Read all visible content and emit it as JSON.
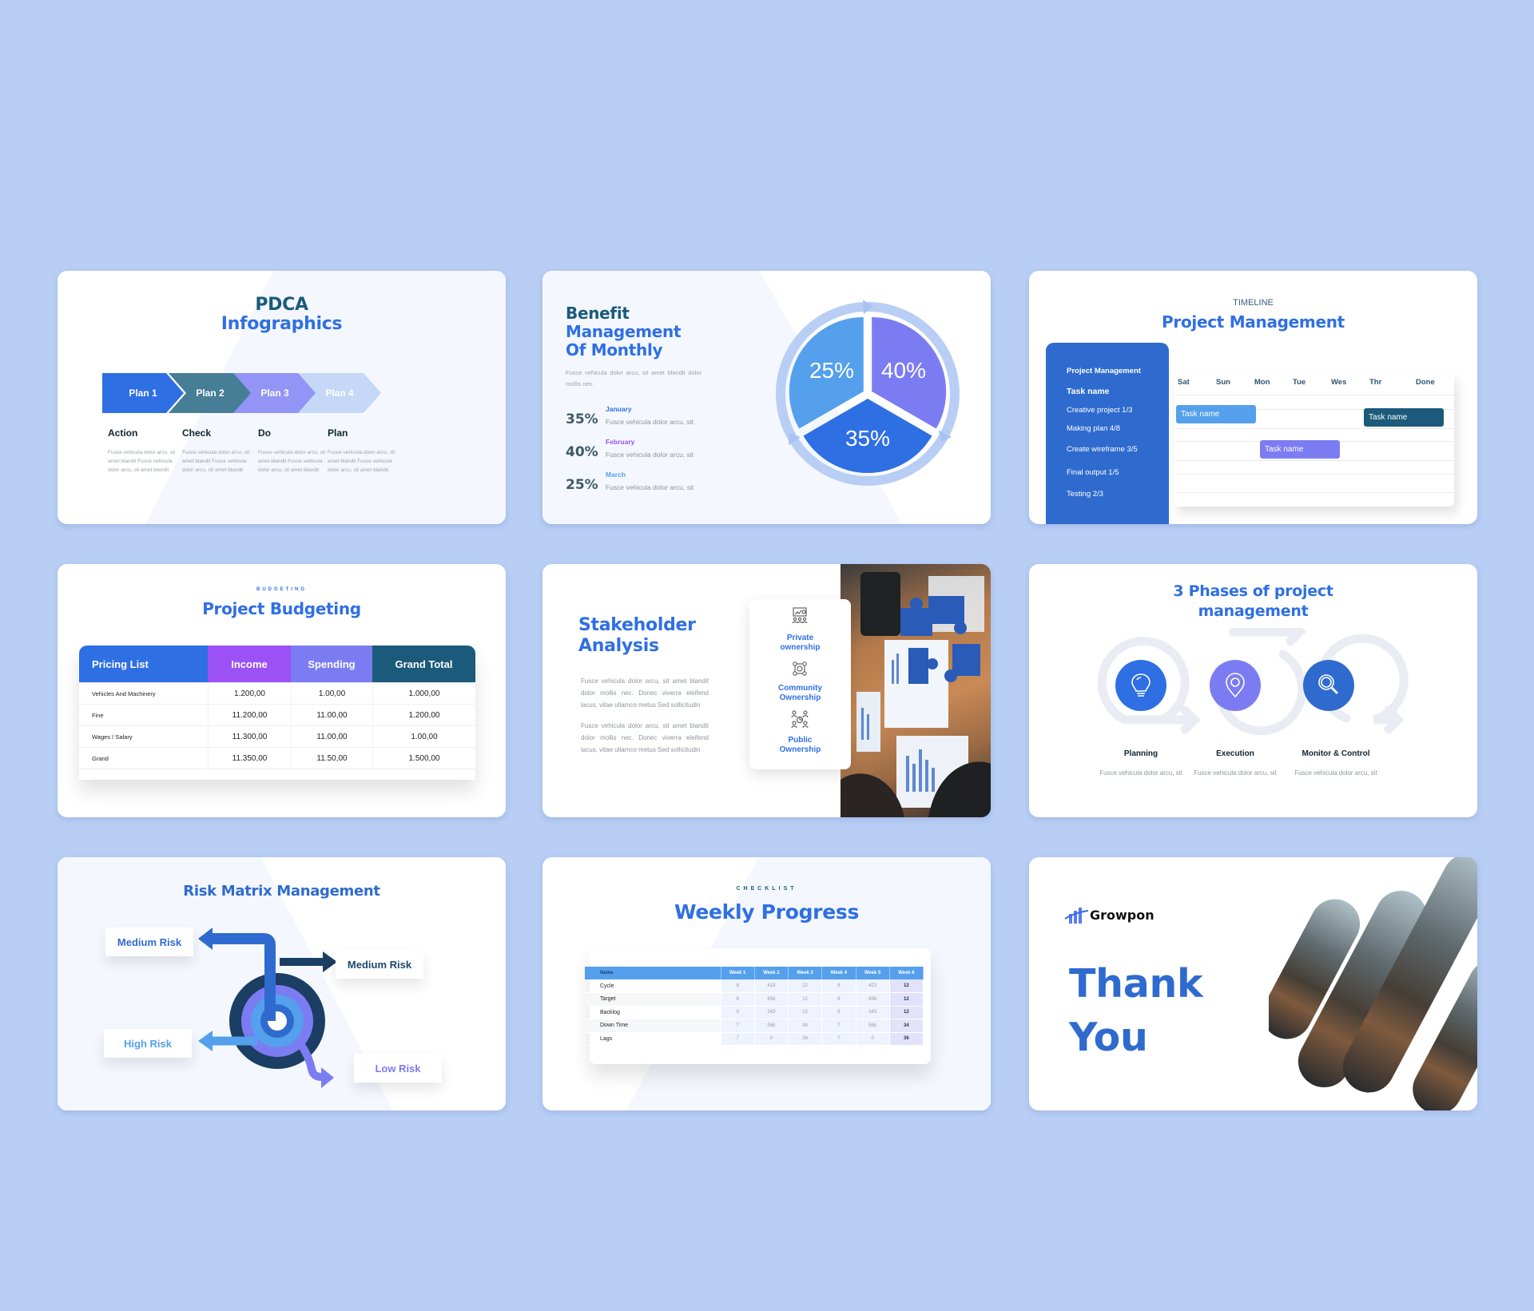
{
  "colors": {
    "background": "#B8CEF5",
    "primary_blue": "#2F6FE4",
    "teal": "#1B5A7A",
    "purple": "#7C7CF2",
    "light_blue": "#54A0EC",
    "violet": "#9B51F5"
  },
  "slides": {
    "pdca": {
      "title_line1": "PDCA",
      "title_line2": "Infographics",
      "plans": [
        {
          "label": "Plan 1",
          "color": "#2F6FE4"
        },
        {
          "label": "Plan 2",
          "color": "#467E96"
        },
        {
          "label": "Plan 3",
          "color": "#9294F6"
        },
        {
          "label": "Plan 4",
          "color": "#C5D8F7"
        }
      ],
      "steps": [
        {
          "title": "Action",
          "desc": "Fusce vehicula dolor arcu, sit amet blandit Fusce vehicula dolor arcu, sit amet blandit"
        },
        {
          "title": "Check",
          "desc": "Fusce vehicula dolor arcu, sit amet blandit Fusce vehicula dolor arcu, sit amet blandit"
        },
        {
          "title": "Do",
          "desc": "Fusce vehicula dolor arcu, sit amet blandit Fusce vehicula dolor arcu, sit amet blandit"
        },
        {
          "title": "Plan",
          "desc": "Fusce vehicula dolor arcu, sit amet blandit Fusce vehicula dolor arcu, sit amet blandit"
        }
      ]
    },
    "benefit": {
      "title_line1": "Benefit",
      "title_line2": "Management",
      "title_line3": "Of Monthly",
      "subtitle": "Fusce vehicula dolor arcu, sit amet blandit dolor mollis nec.",
      "rows": [
        {
          "pct": "35%",
          "month": "January",
          "month_color": "#2F6FE4",
          "desc": "Fusce vehicula dolor arcu, sit"
        },
        {
          "pct": "40%",
          "month": "February",
          "month_color": "#9B51F5",
          "desc": "Fusce vehicula dolor arcu, sit"
        },
        {
          "pct": "25%",
          "month": "March",
          "month_color": "#54A0EC",
          "desc": "Fusce vehicula dolor arcu, sit"
        }
      ],
      "pie": [
        {
          "label": "25%",
          "value": 25,
          "color": "#54A0EC"
        },
        {
          "label": "40%",
          "value": 40,
          "color": "#7C7CF2"
        },
        {
          "label": "35%",
          "value": 35,
          "color": "#2F6FE4"
        }
      ]
    },
    "timeline": {
      "eyebrow": "TIMELINE",
      "title": "Project Management",
      "sidebar_heading": "Project Management",
      "sidebar_subheading": "Task name",
      "tasks": [
        "Creative project 1/3",
        "Making plan 4/8",
        "Create wireframe 3/5",
        "Final output 1/5",
        "Testing 2/3"
      ],
      "days": [
        "Sat",
        "Sun",
        "Mon",
        "Tue",
        "Wes",
        "Thr",
        "Done"
      ],
      "bars": [
        {
          "label": "Task name",
          "color": "#54A0EC"
        },
        {
          "label": "Task name",
          "color": "#1B5A7A"
        },
        {
          "label": "Task name",
          "color": "#7C7CF2"
        }
      ]
    },
    "budgeting": {
      "eyebrow": "BUDGETING",
      "title": "Project Budgeting",
      "headers": [
        {
          "label": "Pricing List",
          "color": "#2F6FE4"
        },
        {
          "label": "Income",
          "color": "#9B51F5"
        },
        {
          "label": "Spending",
          "color": "#7C7CF2"
        },
        {
          "label": "Grand Total",
          "color": "#1B5A7A"
        }
      ],
      "rows": [
        [
          "Vehicles And Machinery",
          "1.200,00",
          "1.00,00",
          "1.000,00"
        ],
        [
          "Fine",
          "11.200,00",
          "11.00,00",
          "1.200,00"
        ],
        [
          "Wages / Salary",
          "11.300,00",
          "11.00,00",
          "1.00,00"
        ],
        [
          "Grand",
          "11.350,00",
          "11.50,00",
          "1.500,00"
        ]
      ]
    },
    "stakeholder": {
      "title_line1": "Stakeholder",
      "title_line2": "Analysis",
      "paragraphs": [
        "Fusce vehicula dolor arcu, sit amet blandit dolor mollis nec. Donec viverra eleifend lacus, vitae ullamco metus Sed sollicitudin",
        "Fusce vehicula dolor arcu, sit amet blandit dolor mollis nec. Donec viverra eleifend lacus, vitae ullamco metus Sed sollicitudin"
      ],
      "items": [
        {
          "line1": "Private",
          "line2": "ownership",
          "icon": "presentation-group-icon"
        },
        {
          "line1": "Community",
          "line2": "Ownership",
          "icon": "community-network-icon"
        },
        {
          "line1": "Public",
          "line2": "Ownership",
          "icon": "public-group-icon"
        }
      ]
    },
    "phases": {
      "title_line1": "3 Phases of project",
      "title_line2": "management",
      "phases": [
        {
          "label": "Planning",
          "desc": "Fusce vehicula dolor arcu, sit",
          "color": "#2F6FE4",
          "icon": "lightbulb-icon"
        },
        {
          "label": "Execution",
          "desc": "Fusce vehicula dolor arcu, sit",
          "color": "#7C7CF2",
          "icon": "location-pin-icon"
        },
        {
          "label": "Monitor & Control",
          "desc": "Fusce vehicula dolor arcu, sit",
          "color": "#2F6BCF",
          "icon": "magnifier-icon"
        }
      ]
    },
    "risk": {
      "title": "Risk Matrix Management",
      "labels": [
        {
          "text": "Medium Risk",
          "color": "#2F6BCF"
        },
        {
          "text": "Medium Risk",
          "color": "#1B4A6A"
        },
        {
          "text": "High Risk",
          "color": "#54A0EC"
        },
        {
          "text": "Low Risk",
          "color": "#7C7CF2"
        }
      ]
    },
    "weekly": {
      "eyebrow": "CHECKLIST",
      "title": "Weekly Progress",
      "headers": [
        "Name",
        "Week 1",
        "Week 2",
        "Week 3",
        "Week 4",
        "Week 5",
        "Week 6"
      ],
      "rows": [
        [
          "Cycle",
          "8",
          "423",
          "12",
          "8",
          "423",
          "12"
        ],
        [
          "Target",
          "8",
          "856",
          "12",
          "8",
          "856",
          "12"
        ],
        [
          "Backlog",
          "9",
          "343",
          "12",
          "9",
          "343",
          "12"
        ],
        [
          "Down Time",
          "7",
          "565",
          "34",
          "7",
          "565",
          "34"
        ],
        [
          "Lags",
          "7",
          "0",
          "36",
          "7",
          "0",
          "36"
        ]
      ]
    },
    "thanks": {
      "brand": "Growpon",
      "line1": "Thank",
      "line2": "You"
    }
  }
}
